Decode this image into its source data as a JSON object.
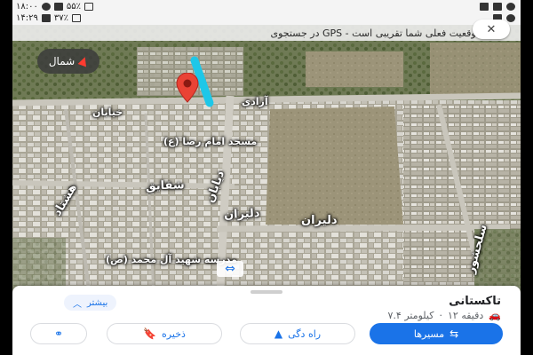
{
  "status_bar": {
    "time": "۱۸:۰۰",
    "battery": "۵۵٪",
    "network_speed_top": "۱۸:۰۰",
    "clock_second": "۱۴:۲۹",
    "battery_second": "۳۷٪"
  },
  "banner": {
    "text": "در جستجوی GPS - موقعیت فعلی شما تقریبی است",
    "close_glyph": "✕"
  },
  "map": {
    "compass_label": "شمال",
    "labels": {
      "road_left": "هشتاد",
      "road_center": "دلبران",
      "road_center2": "دلیران",
      "road_vertical": "دیابان",
      "road_mid": "شقایق",
      "road_right_vertical": "سلحشور",
      "mosque": "مسجد امام رضا (ع)",
      "school": "مدرسه شهید آل محمد (ص)",
      "top_left_small": "خیابان",
      "top_road": "آزادی"
    }
  },
  "sheet": {
    "title": "تاکستانی",
    "duration": "۱۲ دقیقه",
    "distance": "۷.۴ کیلومتر",
    "more_label": "بیشتر",
    "actions": {
      "directions": "مسیرها",
      "navigate": "راه‌ دگی",
      "save": "ذخیره",
      "share_icon": "share-icon"
    }
  }
}
